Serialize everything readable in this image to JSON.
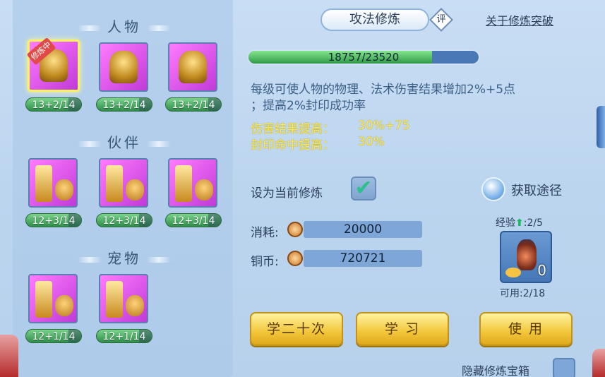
{
  "sections": {
    "characters": "人物",
    "partners": "伙伴",
    "pets": "宠物"
  },
  "character_slots": [
    {
      "level": "13+2/14",
      "badge": "修炼中",
      "active": true,
      "icon": "meditating-warrior-icon"
    },
    {
      "level": "13+2/14",
      "icon": "shield-warrior-icon"
    },
    {
      "level": "13+2/14",
      "icon": "glowing-warrior-icon"
    }
  ],
  "partner_slots": [
    {
      "level": "12+3/14",
      "icon": "sword-lion-icon"
    },
    {
      "level": "12+3/14",
      "icon": "shield-lion-icon"
    },
    {
      "level": "12+3/14",
      "icon": "gauntlet-lion-icon"
    }
  ],
  "pet_slots": [
    {
      "level": "12+1/14",
      "icon": "sword-cat-icon"
    },
    {
      "level": "12+1/14",
      "icon": "shield-cat-icon"
    }
  ],
  "header": {
    "tab_title": "攻法修炼",
    "rate_label": "评",
    "about_link": "关于修炼突破"
  },
  "progress": {
    "text": "18757/23520",
    "current": 18757,
    "max": 23520
  },
  "description": {
    "line1": "每级可使人物的物理、法术伤害结果增加2%+5点",
    "line2": "；提高2%封印成功率"
  },
  "stats": [
    {
      "label": "伤害结果提高：",
      "value": "30%+75"
    },
    {
      "label": "封印命中提高：",
      "value": "30%"
    }
  ],
  "set_current": {
    "label": "设为当前修炼",
    "checked": true,
    "check_glyph": "✔"
  },
  "obtain": {
    "label": "获取途径"
  },
  "costs": {
    "consume_label": "消耗:",
    "consume_value": "20000",
    "copper_label": "铜币:",
    "copper_value": "720721"
  },
  "item": {
    "exp_label": "经验",
    "exp_value": ":2/5",
    "exp_arrow": "⬆",
    "count": "0",
    "available": "可用:2/18"
  },
  "buttons": {
    "learn_twenty": "学二十次",
    "learn": "学 习",
    "use": "使 用"
  },
  "hide_box_label": "隐藏修炼宝箱",
  "colors": {
    "accent_yellow": "#ffe84a",
    "progress_green": "#2f9a47",
    "panel_blue": "#b9d4ee",
    "button_gold": "#f2c63a"
  }
}
